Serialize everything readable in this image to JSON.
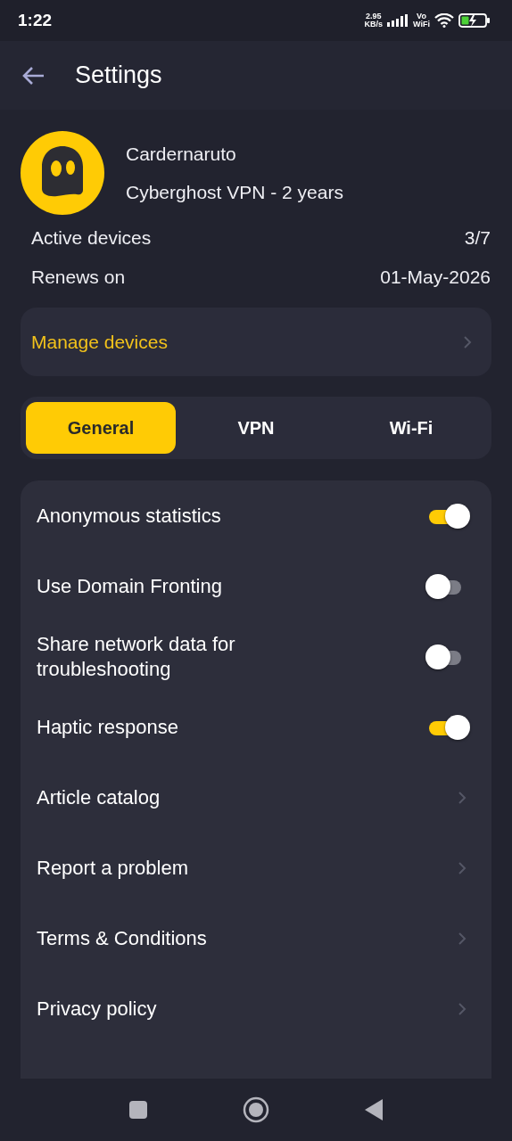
{
  "status_bar": {
    "time": "1:22",
    "speed": "2.95",
    "speed_unit": "KB/s",
    "vowifi_top": "Vo",
    "vowifi_bottom": "WiFi"
  },
  "app_bar": {
    "title": "Settings"
  },
  "profile": {
    "name": "Cardernaruto",
    "plan": "Cyberghost VPN - 2 years"
  },
  "info_rows": [
    {
      "label": "Active devices",
      "value": "3/7"
    },
    {
      "label": "Renews on",
      "value": "01-May-2026"
    }
  ],
  "manage_devices": {
    "label": "Manage devices"
  },
  "tabs": [
    {
      "label": "General",
      "selected": true
    },
    {
      "label": "VPN",
      "selected": false
    },
    {
      "label": "Wi-Fi",
      "selected": false
    }
  ],
  "settings": [
    {
      "kind": "toggle",
      "label": "Anonymous statistics",
      "on": true
    },
    {
      "kind": "toggle",
      "label": "Use Domain Fronting",
      "on": false
    },
    {
      "kind": "toggle",
      "label": "Share network data for troubleshooting",
      "on": false
    },
    {
      "kind": "toggle",
      "label": "Haptic response",
      "on": true
    },
    {
      "kind": "link",
      "label": "Article catalog"
    },
    {
      "kind": "link",
      "label": "Report a problem"
    },
    {
      "kind": "link",
      "label": "Terms & Conditions"
    },
    {
      "kind": "link",
      "label": "Privacy policy"
    }
  ]
}
